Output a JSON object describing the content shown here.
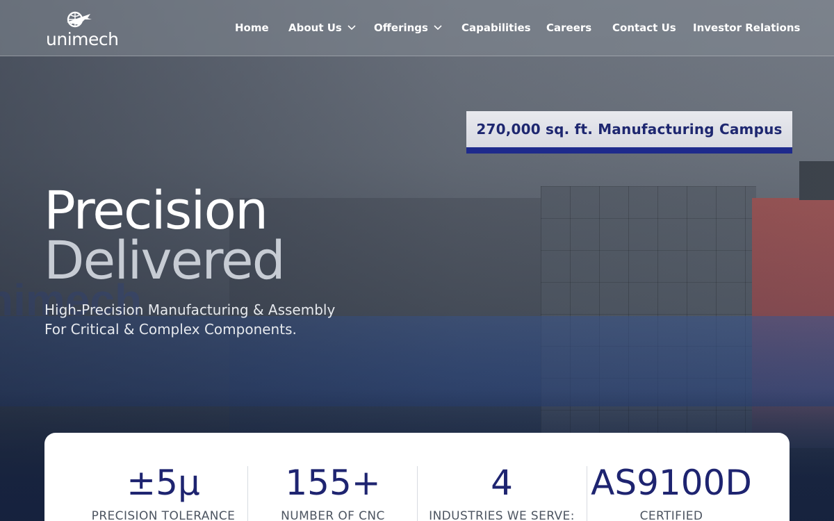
{
  "brand": {
    "logo_text": "unimech"
  },
  "nav": {
    "items": [
      {
        "label": "Home"
      },
      {
        "label": "About Us"
      },
      {
        "label": "Offerings"
      },
      {
        "label": "Capabilities"
      },
      {
        "label": "Careers"
      },
      {
        "label": "Contact Us"
      },
      {
        "label": "Investor Relations"
      }
    ]
  },
  "hero": {
    "sign_text": "270,000 sq. ft. Manufacturing Campus",
    "headline_line1": "Precision",
    "headline_line2": "Delivered",
    "subtitle_line1": "High-Precision Manufacturing & Assembly",
    "subtitle_line2": "For Critical & Complex Components."
  },
  "stats": [
    {
      "value": "±5µ",
      "label": "PRECISION TOLERANCE"
    },
    {
      "value": "155+",
      "label": "NUMBER OF CNC"
    },
    {
      "value": "4",
      "label": "INDUSTRIES WE SERVE:"
    },
    {
      "value": "AS9100D",
      "label": "CERTIFIED"
    }
  ],
  "colors": {
    "stat_value": "#1e2470",
    "sign_band": "#1e2a8c",
    "nav_text": "#ffffff"
  },
  "icons": [
    "globe-plane-logo-icon",
    "chevron-down-icon"
  ]
}
